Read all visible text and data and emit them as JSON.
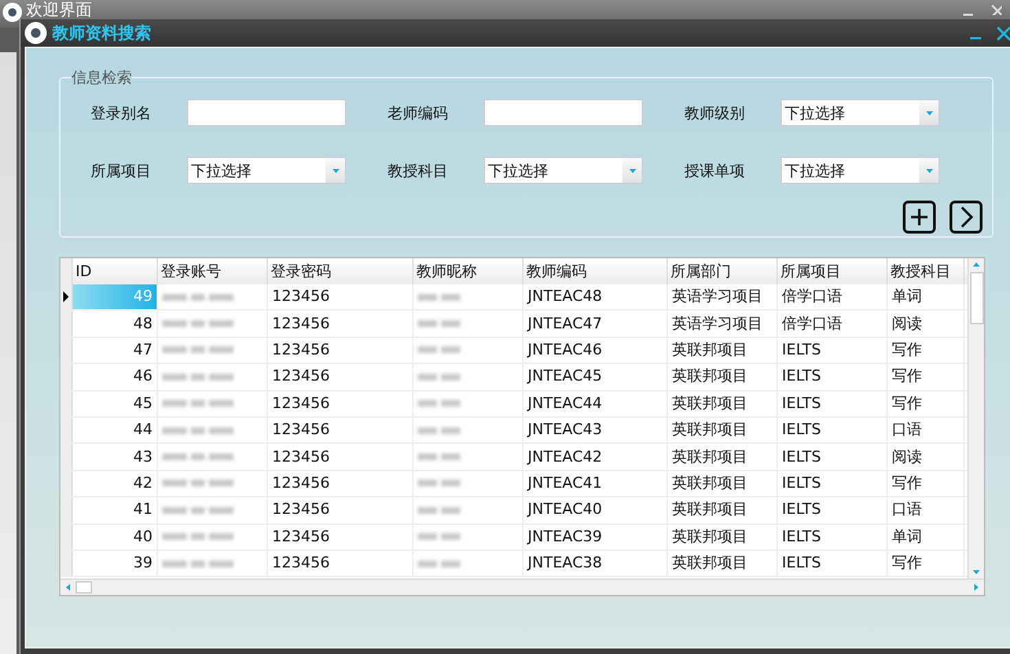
{
  "outer_window": {
    "title": "欢迎界面"
  },
  "window": {
    "title": "教师资料搜索"
  },
  "search_group": {
    "title": "信息检索",
    "fields": [
      {
        "label": "登录别名",
        "kind": "text"
      },
      {
        "label": "老师编码",
        "kind": "text"
      },
      {
        "label": "教师级别",
        "kind": "dropdown",
        "value": "下拉选择"
      },
      {
        "label": "所属项目",
        "kind": "dropdown",
        "value": "下拉选择"
      },
      {
        "label": "教授科目",
        "kind": "dropdown",
        "value": "下拉选择"
      },
      {
        "label": "授课单项",
        "kind": "dropdown",
        "value": "下拉选择"
      }
    ]
  },
  "table": {
    "columns": [
      "ID",
      "登录账号",
      "登录密码",
      "教师昵称",
      "教师编码",
      "所属部门",
      "所属项目",
      "教授科目"
    ],
    "rows": [
      {
        "id": "49",
        "password": "123456",
        "code": "JNTEAC48",
        "department": "英语学习项目",
        "project": "倍学口语",
        "subject": "单词",
        "selected": true
      },
      {
        "id": "48",
        "password": "123456",
        "code": "JNTEAC47",
        "department": "英语学习项目",
        "project": "倍学口语",
        "subject": "阅读",
        "selected": false
      },
      {
        "id": "47",
        "password": "123456",
        "code": "JNTEAC46",
        "department": "英联邦项目",
        "project": "IELTS",
        "subject": "写作",
        "selected": false
      },
      {
        "id": "46",
        "password": "123456",
        "code": "JNTEAC45",
        "department": "英联邦项目",
        "project": "IELTS",
        "subject": "写作",
        "selected": false
      },
      {
        "id": "45",
        "password": "123456",
        "code": "JNTEAC44",
        "department": "英联邦项目",
        "project": "IELTS",
        "subject": "写作",
        "selected": false
      },
      {
        "id": "44",
        "password": "123456",
        "code": "JNTEAC43",
        "department": "英联邦项目",
        "project": "IELTS",
        "subject": "口语",
        "selected": false
      },
      {
        "id": "43",
        "password": "123456",
        "code": "JNTEAC42",
        "department": "英联邦项目",
        "project": "IELTS",
        "subject": "阅读",
        "selected": false
      },
      {
        "id": "42",
        "password": "123456",
        "code": "JNTEAC41",
        "department": "英联邦项目",
        "project": "IELTS",
        "subject": "写作",
        "selected": false
      },
      {
        "id": "41",
        "password": "123456",
        "code": "JNTEAC40",
        "department": "英联邦项目",
        "project": "IELTS",
        "subject": "口语",
        "selected": false
      },
      {
        "id": "40",
        "password": "123456",
        "code": "JNTEAC39",
        "department": "英联邦项目",
        "project": "IELTS",
        "subject": "单词",
        "selected": false
      },
      {
        "id": "39",
        "password": "123456",
        "code": "JNTEAC38",
        "department": "英联邦项目",
        "project": "IELTS",
        "subject": "写作",
        "selected": false
      }
    ]
  }
}
